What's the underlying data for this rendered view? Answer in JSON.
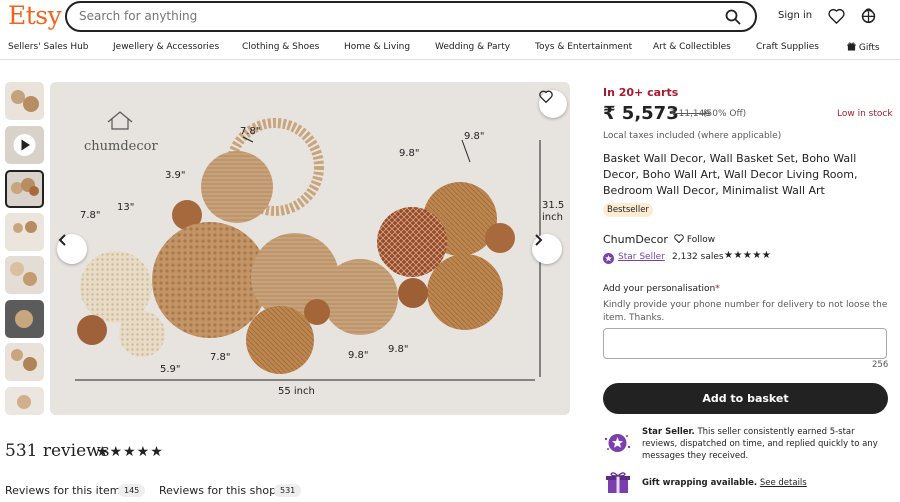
{
  "header": {
    "logo": "Etsy",
    "search_placeholder": "Search for anything",
    "sign_in": "Sign in"
  },
  "categories": [
    "Sellers' Sales Hub",
    "Jewellery & Accessories",
    "Clothing & Shoes",
    "Home & Living",
    "Wedding & Party",
    "Toys & Entertainment",
    "Art & Collectibles",
    "Craft Supplies",
    "Gifts"
  ],
  "image": {
    "brand": "chumdecor",
    "dims": {
      "top_left": "7.8\"",
      "small_left": "3.9\"",
      "left_top": "7.8\"",
      "left_mid": "13\"",
      "center_top": "9.8\"",
      "right_top": "9.8\"",
      "bottom_left": "5.9\"",
      "bottom_mid": "7.8\"",
      "bottom_center": "9.8\"",
      "bottom_right": "9.8\"",
      "height": "31.5",
      "height_unit": "inch",
      "width": "55 inch"
    }
  },
  "reviews": {
    "title": "531 reviews",
    "stars": "★★★★★",
    "tab_item": "Reviews for this item",
    "tab_item_count": "145",
    "tab_shop": "Reviews for this shop",
    "tab_shop_count": "531"
  },
  "product": {
    "in_carts": "In 20+ carts",
    "price": "₹ 5,573",
    "old_price": "₹ 11,146",
    "discount": "(50% Off)",
    "stock": "Low in stock",
    "taxes": "Local taxes included (where applicable)",
    "title": "Basket Wall Decor, Wall Basket Set, Boho Wall Decor, Boho Wall Art, Wall Decor Living Room, Bedroom Wall Decor, Minimalist Wall Art",
    "badge": "Bestseller",
    "shop": "ChumDecor",
    "follow": "Follow",
    "star_seller": "Star Seller",
    "sales": "2,132 sales",
    "sales_stars": "★★★★★",
    "personalisation_label": "Add your personalisation",
    "required_mark": "*",
    "personalisation_help": "Kindly provide your phone number for delivery to not loose the item. Thanks.",
    "char_count": "256",
    "add_to_basket": "Add to basket",
    "star_seller_bold": "Star Seller.",
    "star_seller_text": " This seller consistently earned 5-star reviews, dispatched on time, and replied quickly to any messages they received.",
    "gift_bold": "Gift wrapping available.",
    "gift_link": "See details"
  },
  "colors": {
    "brand": "#f1641e",
    "alert": "#a61a2e",
    "star_seller": "#7b3fad",
    "bestseller_bg": "#fdebd2"
  }
}
